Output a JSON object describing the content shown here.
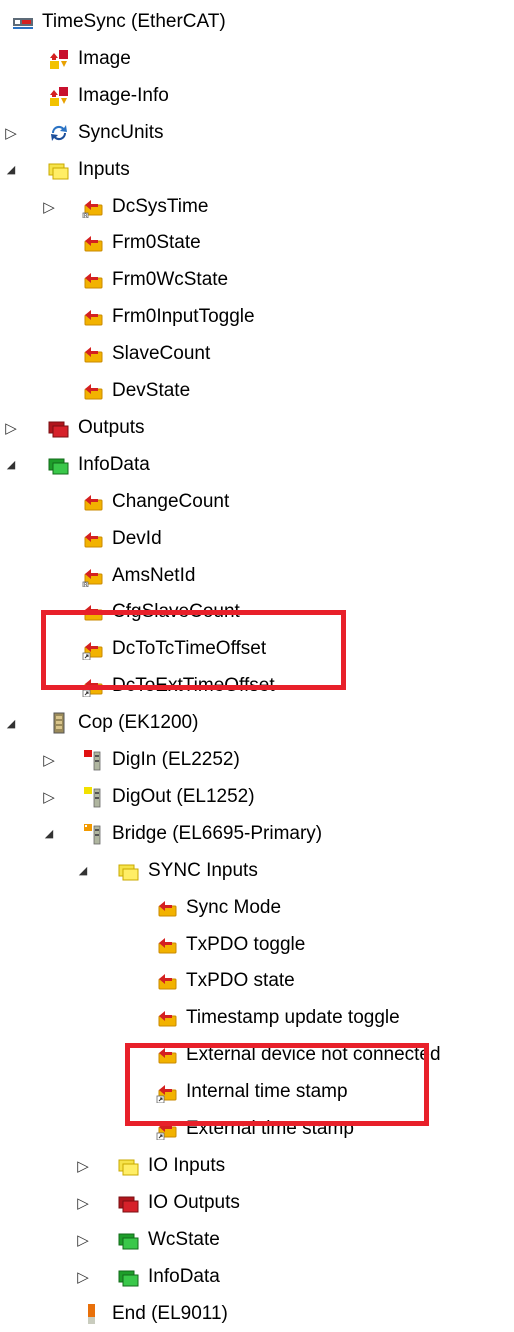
{
  "tree": {
    "root": {
      "label": "TimeSync (EtherCAT)",
      "icon": "ethercat-device-icon"
    },
    "rows": [
      {
        "label": "Image",
        "icon": "image-var-icon",
        "depth": 1,
        "arrow": ""
      },
      {
        "label": "Image-Info",
        "icon": "image-var-icon",
        "depth": 1,
        "arrow": ""
      },
      {
        "label": "SyncUnits",
        "icon": "sync-units-icon",
        "depth": 1,
        "arrow": "collapsed"
      },
      {
        "label": "Inputs",
        "icon": "inputs-folder-icon",
        "depth": 1,
        "arrow": "expanded"
      },
      {
        "label": "DcSysTime",
        "icon": "input-var-linked-icon",
        "depth": 2,
        "arrow": "collapsed"
      },
      {
        "label": "Frm0State",
        "icon": "input-var-icon",
        "depth": 2,
        "arrow": ""
      },
      {
        "label": "Frm0WcState",
        "icon": "input-var-icon",
        "depth": 2,
        "arrow": ""
      },
      {
        "label": "Frm0InputToggle",
        "icon": "input-var-icon",
        "depth": 2,
        "arrow": ""
      },
      {
        "label": "SlaveCount",
        "icon": "input-var-icon",
        "depth": 2,
        "arrow": ""
      },
      {
        "label": "DevState",
        "icon": "input-var-icon",
        "depth": 2,
        "arrow": ""
      },
      {
        "label": "Outputs",
        "icon": "outputs-folder-icon",
        "depth": 1,
        "arrow": "collapsed"
      },
      {
        "label": "InfoData",
        "icon": "infodata-folder-icon",
        "depth": 1,
        "arrow": "expanded"
      },
      {
        "label": "ChangeCount",
        "icon": "input-var-icon",
        "depth": 2,
        "arrow": ""
      },
      {
        "label": "DevId",
        "icon": "input-var-icon",
        "depth": 2,
        "arrow": ""
      },
      {
        "label": "AmsNetId",
        "icon": "input-var-linked-icon",
        "depth": 2,
        "arrow": ""
      },
      {
        "label": "CfgSlaveCount",
        "icon": "input-var-icon",
        "depth": 2,
        "arrow": ""
      },
      {
        "label": "DcToTcTimeOffset",
        "icon": "input-var-mapped-icon",
        "depth": 2,
        "arrow": ""
      },
      {
        "label": "DcToExtTimeOffset",
        "icon": "input-var-mapped-icon",
        "depth": 2,
        "arrow": ""
      },
      {
        "label": "Cop (EK1200)",
        "icon": "coupler-icon",
        "depth": 1,
        "arrow": "expanded"
      },
      {
        "label": "DigIn (EL2252)",
        "icon": "terminal-red-icon",
        "depth": 2,
        "arrow": "collapsed"
      },
      {
        "label": "DigOut (EL1252)",
        "icon": "terminal-yellow-icon",
        "depth": 2,
        "arrow": "collapsed"
      },
      {
        "label": "Bridge (EL6695-Primary)",
        "icon": "terminal-orange-icon",
        "depth": 2,
        "arrow": "expanded"
      },
      {
        "label": "SYNC Inputs",
        "icon": "inputs-folder-icon",
        "depth": 3,
        "arrow": "expanded"
      },
      {
        "label": "Sync Mode",
        "icon": "input-var-icon",
        "depth": 4,
        "arrow": ""
      },
      {
        "label": "TxPDO toggle",
        "icon": "input-var-icon",
        "depth": 4,
        "arrow": ""
      },
      {
        "label": "TxPDO state",
        "icon": "input-var-icon",
        "depth": 4,
        "arrow": ""
      },
      {
        "label": "Timestamp update toggle",
        "icon": "input-var-icon",
        "depth": 4,
        "arrow": ""
      },
      {
        "label": "External device not connected",
        "icon": "input-var-icon",
        "depth": 4,
        "arrow": ""
      },
      {
        "label": "Internal time stamp",
        "icon": "input-var-mapped-icon",
        "depth": 4,
        "arrow": ""
      },
      {
        "label": "External time stamp",
        "icon": "input-var-mapped-icon",
        "depth": 4,
        "arrow": ""
      },
      {
        "label": "IO Inputs",
        "icon": "inputs-folder-icon",
        "depth": 3,
        "arrow": "collapsed"
      },
      {
        "label": "IO Outputs",
        "icon": "outputs-folder-icon",
        "depth": 3,
        "arrow": "collapsed"
      },
      {
        "label": "WcState",
        "icon": "infodata-folder-icon",
        "depth": 3,
        "arrow": "collapsed"
      },
      {
        "label": "InfoData",
        "icon": "infodata-folder-icon",
        "depth": 3,
        "arrow": "collapsed"
      },
      {
        "label": "End (EL9011)",
        "icon": "end-terminal-icon",
        "depth": 2,
        "arrow": ""
      }
    ]
  },
  "highlights": [
    {
      "name": "highlight-infodata-offsets"
    },
    {
      "name": "highlight-sync-timestamps"
    }
  ],
  "colors": {
    "highlight": "#e8202a",
    "input_var": "#f2b200",
    "arrow_red": "#d42020"
  }
}
